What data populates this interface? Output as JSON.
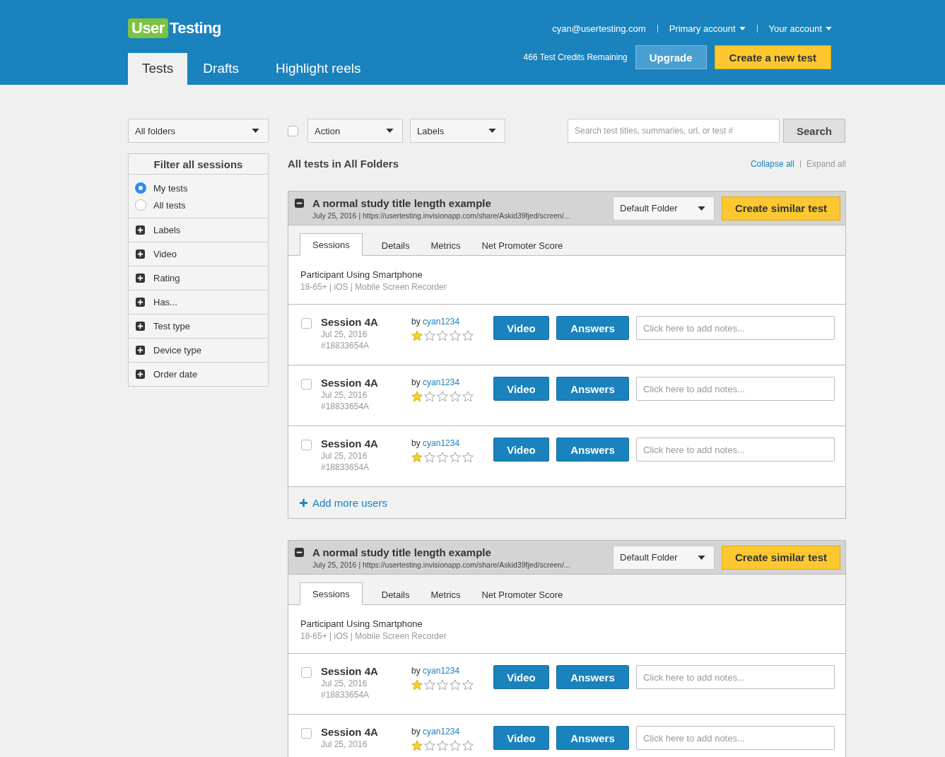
{
  "header": {
    "logo": {
      "part_1": "User",
      "part_2": "Testing"
    },
    "account_links": [
      {
        "label": "cyan@usertesting.com",
        "dropdown": false
      },
      {
        "label": "Primary account",
        "dropdown": true
      },
      {
        "label": "Your account",
        "dropdown": true
      }
    ],
    "nav_tabs": [
      {
        "label": "Tests",
        "selected": true
      },
      {
        "label": "Drafts",
        "selected": false
      },
      {
        "label": "Highlight reels",
        "selected": false
      }
    ],
    "credits": "466 Test Credits Remaining",
    "upgrade_button": "Upgrade",
    "create_button": "Create a new test"
  },
  "sidebar": {
    "folder_select": "All folders",
    "filter_title": "Filter all sessions",
    "radios": [
      {
        "label": "My tests",
        "selected": true
      },
      {
        "label": "All tests",
        "selected": false
      }
    ],
    "filters": [
      {
        "label": "Labels",
        "expanded": false
      },
      {
        "label": "Video",
        "expanded": false
      },
      {
        "label": "Rating",
        "expanded": false
      },
      {
        "label": "Has...",
        "expanded": false
      },
      {
        "label": "Test type",
        "expanded": false
      },
      {
        "label": "Device type",
        "expanded": false
      },
      {
        "label": "Order date",
        "expanded": false
      }
    ]
  },
  "toolbar": {
    "select_all_checked": false,
    "action_select": "Action",
    "labels_select": "Labels",
    "search": {
      "placeholder": "Search test titles, summaries, url, or test #"
    },
    "search_button": "Search"
  },
  "heading": "All tests in All Folders",
  "collapse_all": "Collapse all",
  "expand_all": "Expand all",
  "tests": [
    {
      "title": "A normal study title length example",
      "expanded": true,
      "meta": "July 25, 2016 | https://usertesting.invisionapp.com/share/Askid39fjed/screen/...",
      "folder": "Default Folder",
      "similar_button": "Create similar test",
      "tabs": [
        {
          "label": "Sessions",
          "selected": true
        },
        {
          "label": "Details",
          "selected": false
        },
        {
          "label": "Metrics",
          "selected": false
        },
        {
          "label": "Net Promoter Score",
          "selected": false
        }
      ],
      "participant": "Participant Using Smartphone",
      "participant_meta": "18-65+ | iOS | Mobile Screen Recorder",
      "sessions": [
        {
          "title": "Session 4A",
          "date": "Jul 25, 2016",
          "id": "#18833654A",
          "by": "by",
          "user": "cyan1234",
          "stars": 1,
          "checked": false,
          "video": "Video",
          "answers": "Answers",
          "notes_placeholder": "Click here to add notes..."
        },
        {
          "title": "Session 4A",
          "date": "Jul 25, 2016",
          "id": "#18833654A",
          "by": "by",
          "user": "cyan1234",
          "stars": 1,
          "checked": false,
          "video": "Video",
          "answers": "Answers",
          "notes_placeholder": "Click here to add notes..."
        },
        {
          "title": "Session 4A",
          "date": "Jul 25, 2016",
          "id": "#18833654A",
          "by": "by",
          "user": "cyan1234",
          "stars": 1,
          "checked": false,
          "video": "Video",
          "answers": "Answers",
          "notes_placeholder": "Click here to add notes..."
        }
      ],
      "add_users": "Add more users"
    },
    {
      "title": "A normal study title length example",
      "expanded": true,
      "meta": "July 25, 2016 | https://usertesting.invisionapp.com/share/Askid39fjed/screen/...",
      "folder": "Default Folder",
      "similar_button": "Create similar test",
      "tabs": [
        {
          "label": "Sessions",
          "selected": true
        },
        {
          "label": "Details",
          "selected": false
        },
        {
          "label": "Metrics",
          "selected": false
        },
        {
          "label": "Net Promoter Score",
          "selected": false
        }
      ],
      "participant": "Participant Using Smartphone",
      "participant_meta": "18-65+ | iOS | Mobile Screen Recorder",
      "sessions": [
        {
          "title": "Session 4A",
          "date": "Jul 25, 2016",
          "id": "#18833654A",
          "by": "by",
          "user": "cyan1234",
          "stars": 1,
          "checked": false,
          "video": "Video",
          "answers": "Answers",
          "notes_placeholder": "Click here to add notes..."
        },
        {
          "title": "Session 4A",
          "date": "Jul 25, 2016",
          "by": "by",
          "user": "cyan1234",
          "stars": 1,
          "checked": false,
          "video": "Video",
          "answers": "Answers",
          "notes_placeholder": "Click here to add notes..."
        }
      ]
    }
  ]
}
